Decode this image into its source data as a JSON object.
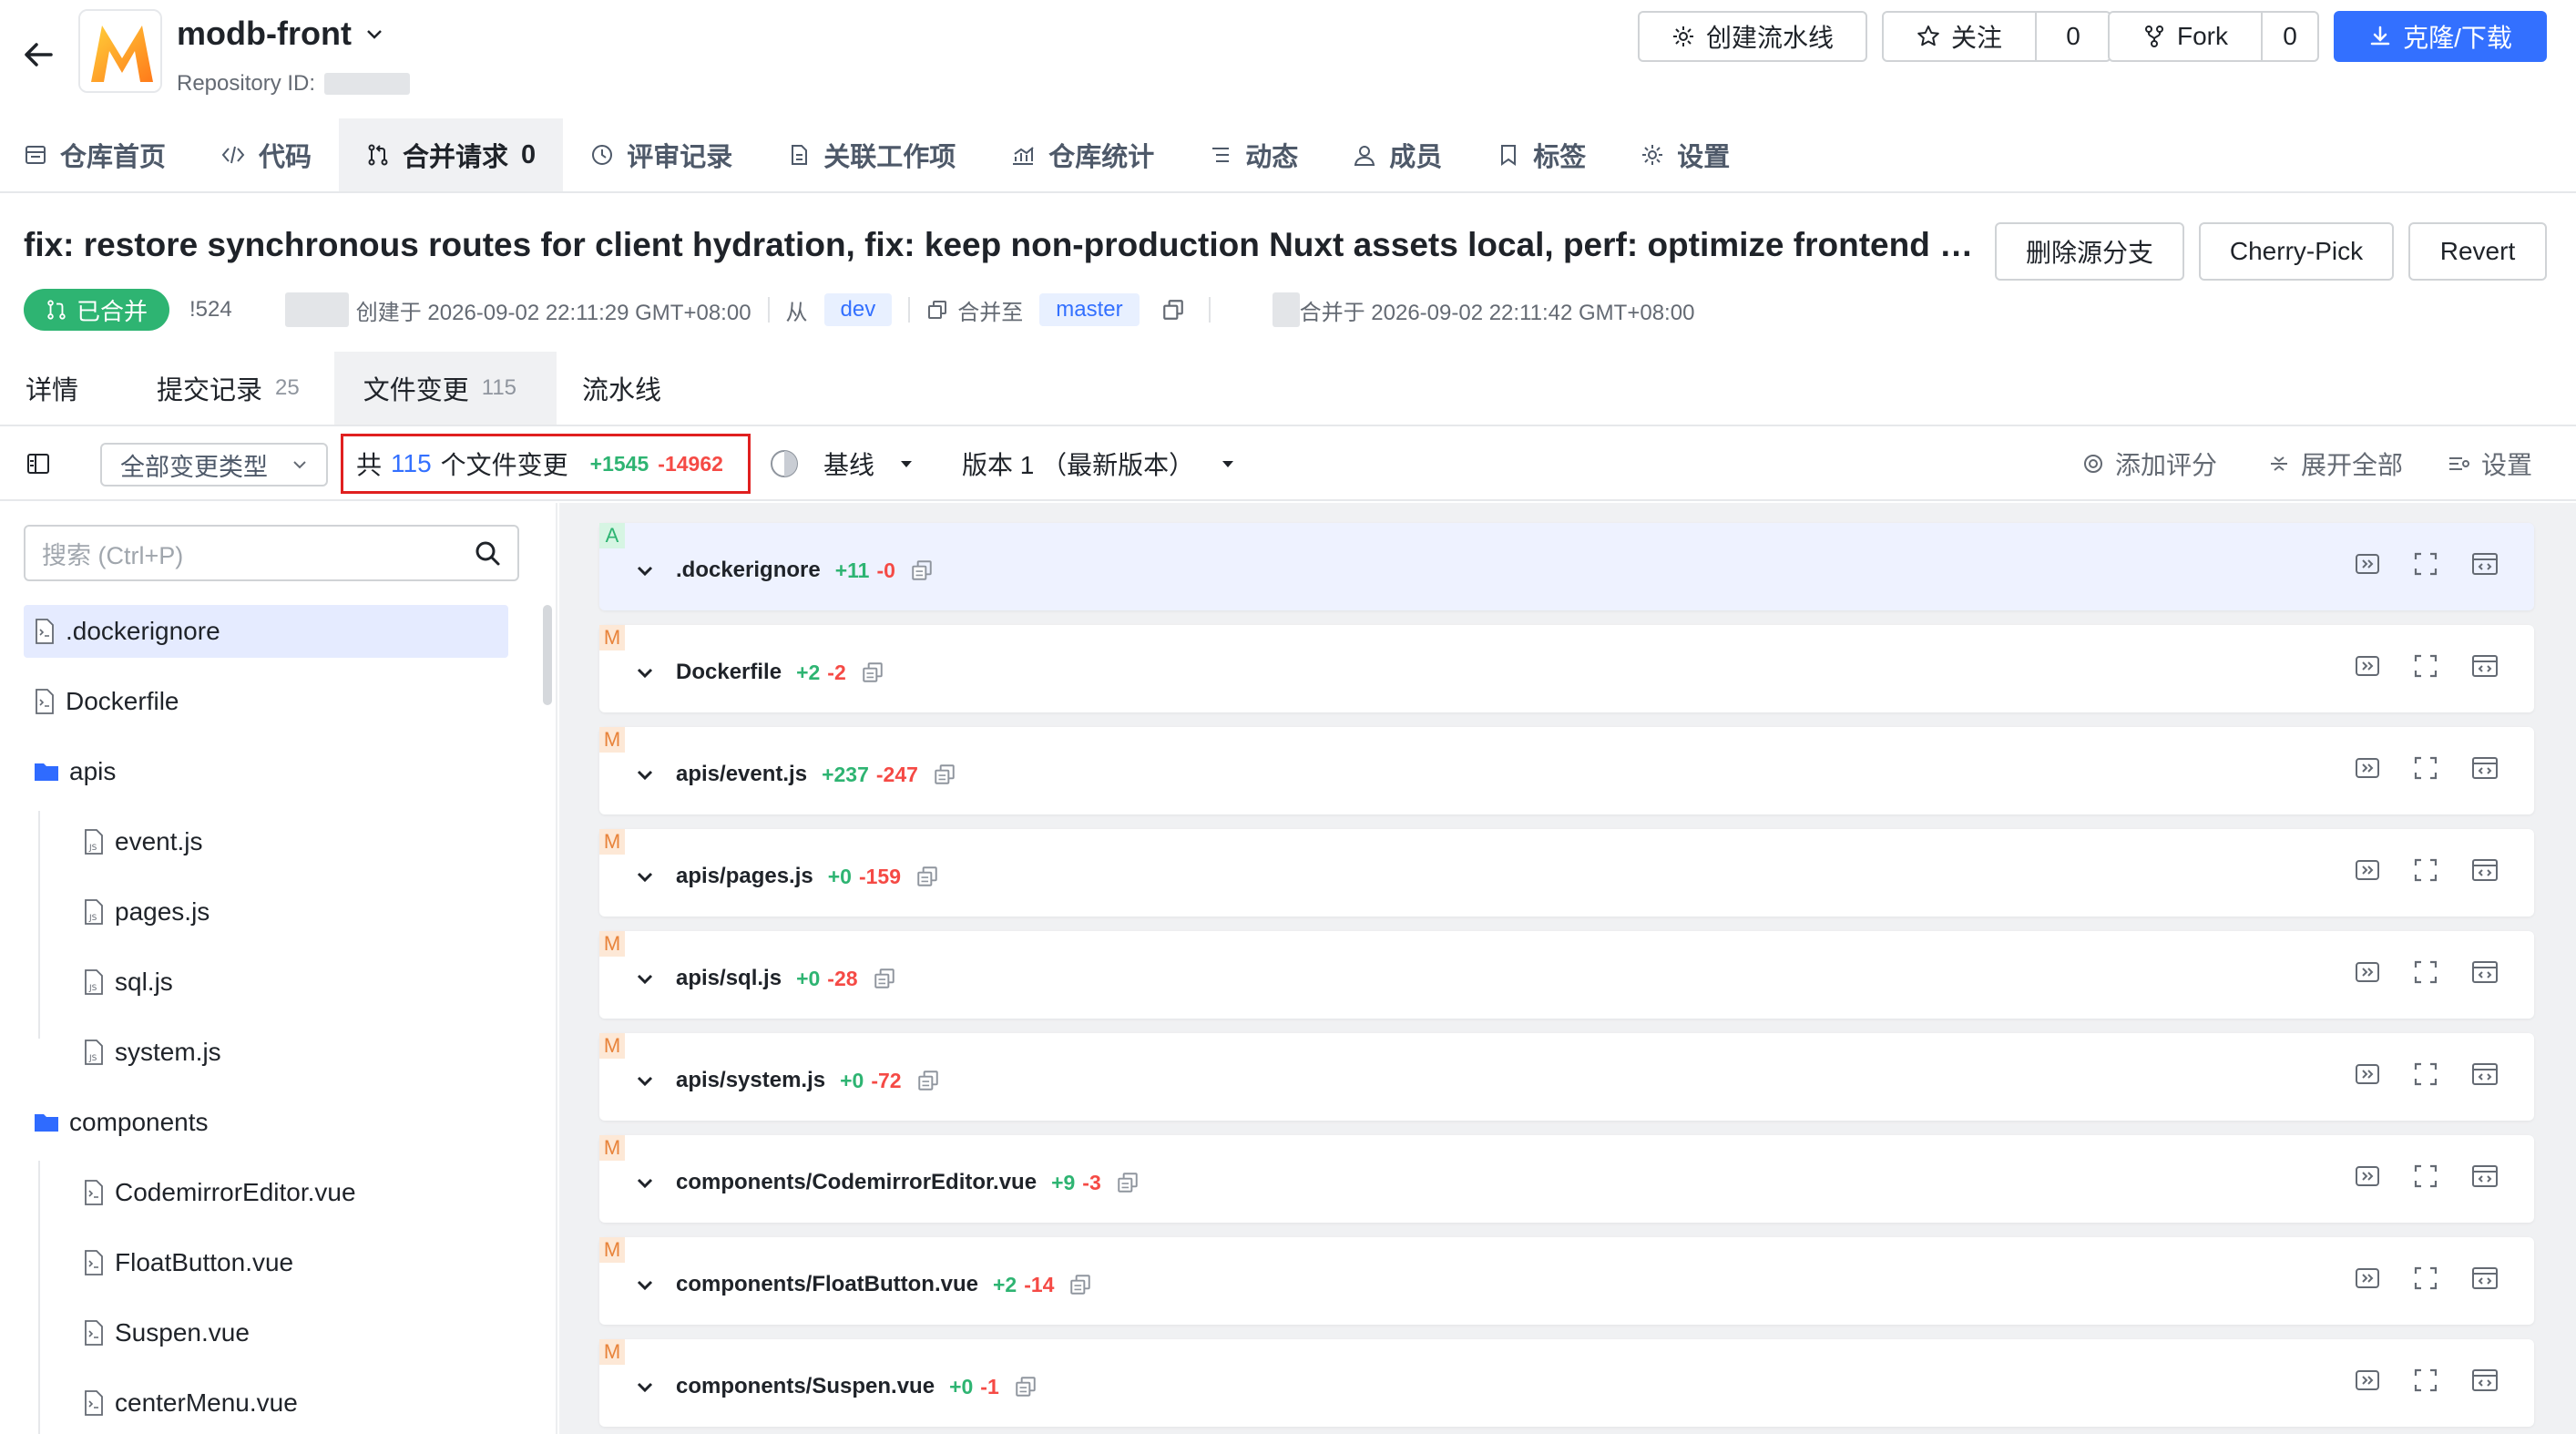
{
  "header": {
    "repo_name": "modb-front",
    "repo_id_label": "Repository ID:",
    "logo_letter": "M",
    "create_pipeline": "创建流水线",
    "watch_label": "关注",
    "watch_count": "0",
    "fork_label": "Fork",
    "fork_count": "0",
    "clone_label": "克隆/下载"
  },
  "nav": {
    "items": [
      {
        "label": "仓库首页",
        "icon": "repo-home-icon"
      },
      {
        "label": "代码",
        "icon": "code-icon"
      },
      {
        "label": "合并请求",
        "count": "0",
        "icon": "merge-request-icon"
      },
      {
        "label": "评审记录",
        "icon": "review-icon"
      },
      {
        "label": "关联工作项",
        "icon": "work-item-icon"
      },
      {
        "label": "仓库统计",
        "icon": "stats-icon"
      },
      {
        "label": "动态",
        "icon": "activity-icon"
      },
      {
        "label": "成员",
        "icon": "member-icon"
      },
      {
        "label": "标签",
        "icon": "tag-icon"
      },
      {
        "label": "设置",
        "icon": "settings-icon"
      }
    ]
  },
  "mr": {
    "title": "fix: restore synchronous routes for client hydration, fix: keep non-production Nuxt assets local, perf: optimize frontend buil...",
    "status": "已合并",
    "id": "!524",
    "created": "创建于 2026-09-02 22:11:29 GMT+08:00",
    "from_label": "从",
    "source_branch": "dev",
    "merge_to_label": "合并至",
    "target_branch": "master",
    "merged": "合并于 2026-09-02 22:11:42 GMT+08:00",
    "delete_branch": "删除源分支",
    "cherry_pick": "Cherry-Pick",
    "revert": "Revert"
  },
  "subtabs": {
    "details": "详情",
    "commits": "提交记录",
    "commits_count": "25",
    "files": "文件变更",
    "files_count": "115",
    "pipeline": "流水线"
  },
  "toolbar": {
    "change_type": "全部变更类型",
    "summary_prefix": "共",
    "summary_count": "115",
    "summary_suffix": "个文件变更",
    "additions": "+1545",
    "deletions": "-14962",
    "baseline": "基线",
    "version": "版本 1 （最新版本）",
    "add_score": "添加评分",
    "expand_all": "展开全部",
    "settings": "设置"
  },
  "tree": {
    "search_placeholder": "搜索 (Ctrl+P)",
    "items": [
      {
        "name": ".dockerignore",
        "type": "file",
        "depth": 0
      },
      {
        "name": "Dockerfile",
        "type": "file",
        "depth": 0
      },
      {
        "name": "apis",
        "type": "folder",
        "depth": 0
      },
      {
        "name": "event.js",
        "type": "js",
        "depth": 1
      },
      {
        "name": "pages.js",
        "type": "js",
        "depth": 1
      },
      {
        "name": "sql.js",
        "type": "js",
        "depth": 1
      },
      {
        "name": "system.js",
        "type": "js",
        "depth": 1
      },
      {
        "name": "components",
        "type": "folder",
        "depth": 0
      },
      {
        "name": "CodemirrorEditor.vue",
        "type": "file",
        "depth": 1
      },
      {
        "name": "FloatButton.vue",
        "type": "file",
        "depth": 1
      },
      {
        "name": "Suspen.vue",
        "type": "file",
        "depth": 1
      },
      {
        "name": "centerMenu.vue",
        "type": "file",
        "depth": 1
      }
    ]
  },
  "diffs": [
    {
      "status": "A",
      "path": ".dockerignore",
      "add": "+11",
      "del": "-0"
    },
    {
      "status": "M",
      "path": "Dockerfile",
      "add": "+2",
      "del": "-2"
    },
    {
      "status": "M",
      "path": "apis/event.js",
      "add": "+237",
      "del": "-247"
    },
    {
      "status": "M",
      "path": "apis/pages.js",
      "add": "+0",
      "del": "-159"
    },
    {
      "status": "M",
      "path": "apis/sql.js",
      "add": "+0",
      "del": "-28"
    },
    {
      "status": "M",
      "path": "apis/system.js",
      "add": "+0",
      "del": "-72"
    },
    {
      "status": "M",
      "path": "components/CodemirrorEditor.vue",
      "add": "+9",
      "del": "-3"
    },
    {
      "status": "M",
      "path": "components/FloatButton.vue",
      "add": "+2",
      "del": "-14"
    },
    {
      "status": "M",
      "path": "components/Suspen.vue",
      "add": "+0",
      "del": "-1"
    }
  ],
  "colors": {
    "primary": "#3370ff",
    "merged": "#2eb472",
    "added": "#2eb472",
    "deleted": "#f54a45",
    "highlight_border": "#e02020"
  }
}
